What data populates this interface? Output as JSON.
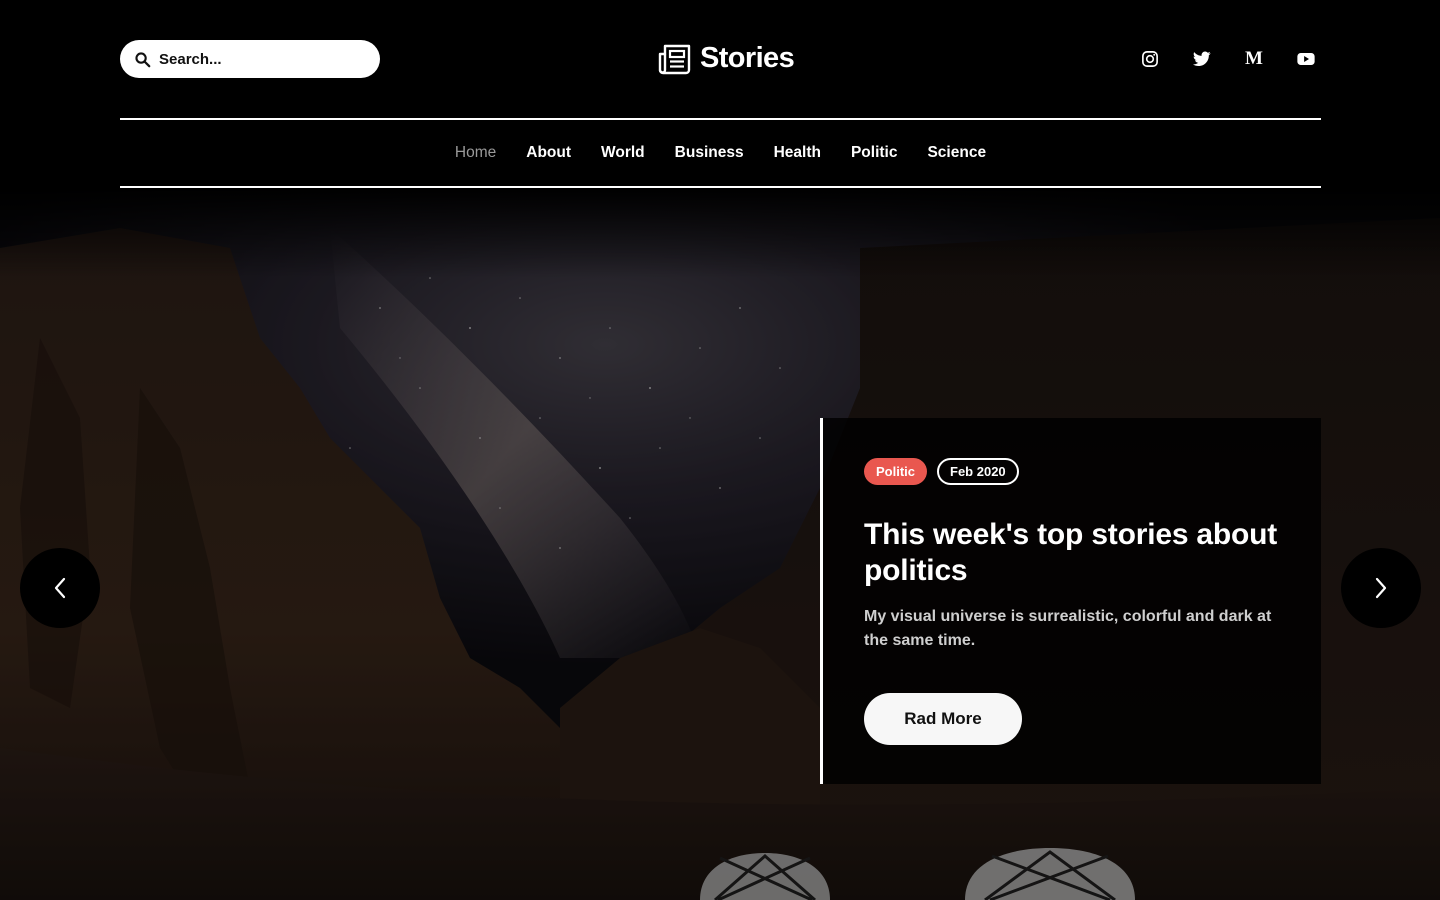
{
  "search": {
    "placeholder": "Search..."
  },
  "brand": {
    "name": "Stories",
    "icon": "newspaper-icon"
  },
  "social": [
    {
      "name": "instagram",
      "icon": "instagram-icon"
    },
    {
      "name": "twitter",
      "icon": "twitter-icon"
    },
    {
      "name": "medium",
      "icon": "medium-icon",
      "glyph": "M"
    },
    {
      "name": "youtube",
      "icon": "youtube-icon"
    }
  ],
  "nav": {
    "items": [
      {
        "label": "Home",
        "active": true
      },
      {
        "label": "About",
        "active": false
      },
      {
        "label": "World",
        "active": false
      },
      {
        "label": "Business",
        "active": false
      },
      {
        "label": "Health",
        "active": false
      },
      {
        "label": "Politic",
        "active": false
      },
      {
        "label": "Science",
        "active": false
      }
    ]
  },
  "hero": {
    "category": "Politic",
    "date": "Feb 2020",
    "title": "This week's top stories about politics",
    "description": "My visual universe is surrealistic, colorful and dark at the same time.",
    "cta_label": "Rad More",
    "prev_icon": "chevron-left-icon",
    "next_icon": "chevron-right-icon"
  },
  "colors": {
    "background": "#000000",
    "category_tag": "#e9574f",
    "button_bg": "#f7f7f7",
    "nav_active": "#9a9a9a"
  }
}
